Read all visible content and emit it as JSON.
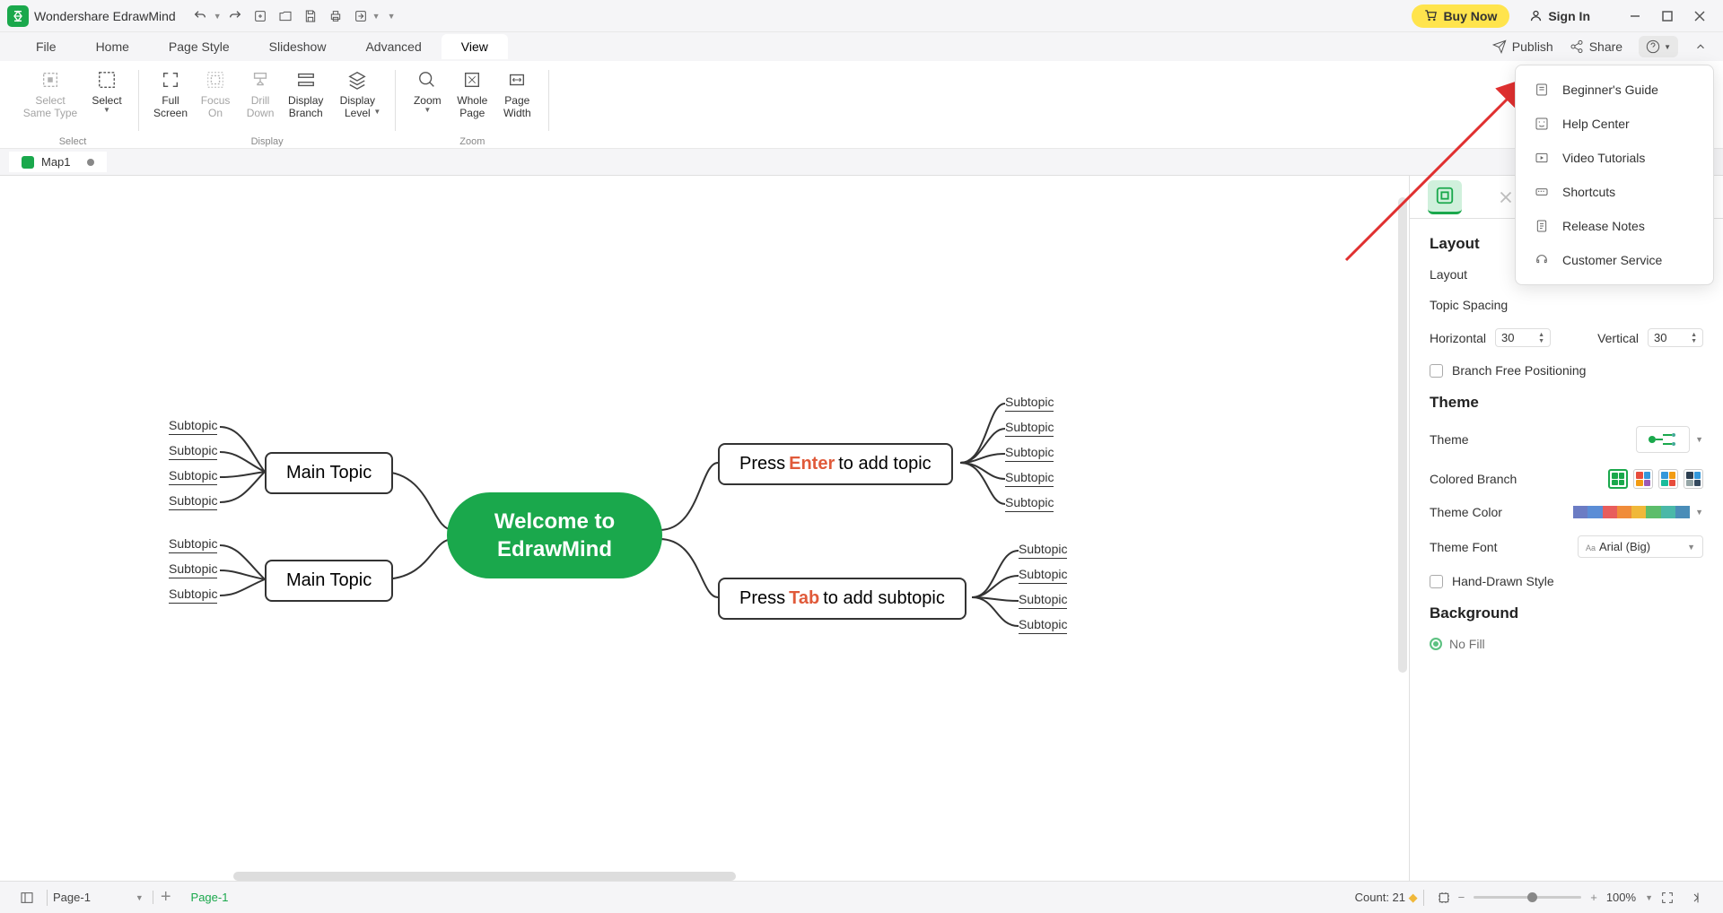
{
  "app_title": "Wondershare EdrawMind",
  "buy_now": "Buy Now",
  "sign_in": "Sign In",
  "menu": [
    "File",
    "Home",
    "Page Style",
    "Slideshow",
    "Advanced",
    "View"
  ],
  "active_menu": "View",
  "right_menu": {
    "publish": "Publish",
    "share": "Share"
  },
  "ribbon": {
    "select_same": "Select Same Type",
    "select": "Select",
    "select_grp": "Select",
    "full_screen": "Full Screen",
    "focus_on": "Focus On",
    "drill_down": "Drill Down",
    "display_branch": "Display Branch",
    "display_level": "Display Level",
    "display_grp": "Display",
    "zoom": "Zoom",
    "whole_page": "Whole Page",
    "page_width": "Page Width",
    "zoom_grp": "Zoom"
  },
  "doc_tab": "Map1",
  "mindmap": {
    "central_l1": "Welcome to",
    "central_l2": "EdrawMind",
    "main_topic": "Main Topic",
    "press": "Press ",
    "enter_key": "Enter",
    "enter_rest": " to add topic",
    "tab_key": "Tab",
    "tab_rest": " to add subtopic",
    "subtopic": "Subtopic"
  },
  "panel": {
    "layout_title": "Layout",
    "layout_label": "Layout",
    "topic_spacing": "Topic Spacing",
    "horizontal": "Horizontal",
    "h_val": "30",
    "vertical": "Vertical",
    "v_val": "30",
    "branch_free": "Branch Free Positioning",
    "theme_title": "Theme",
    "theme_label": "Theme",
    "colored_branch": "Colored Branch",
    "theme_color": "Theme Color",
    "theme_font": "Theme Font",
    "theme_font_val": "Arial (Big)",
    "hand_drawn": "Hand-Drawn Style",
    "background_title": "Background",
    "no_fill": "No Fill"
  },
  "help_menu": [
    "Beginner's Guide",
    "Help Center",
    "Video Tutorials",
    "Shortcuts",
    "Release Notes",
    "Customer Service"
  ],
  "status": {
    "page_sel": "Page-1",
    "page_link": "Page-1",
    "count": "Count: 21",
    "zoom": "100%"
  }
}
